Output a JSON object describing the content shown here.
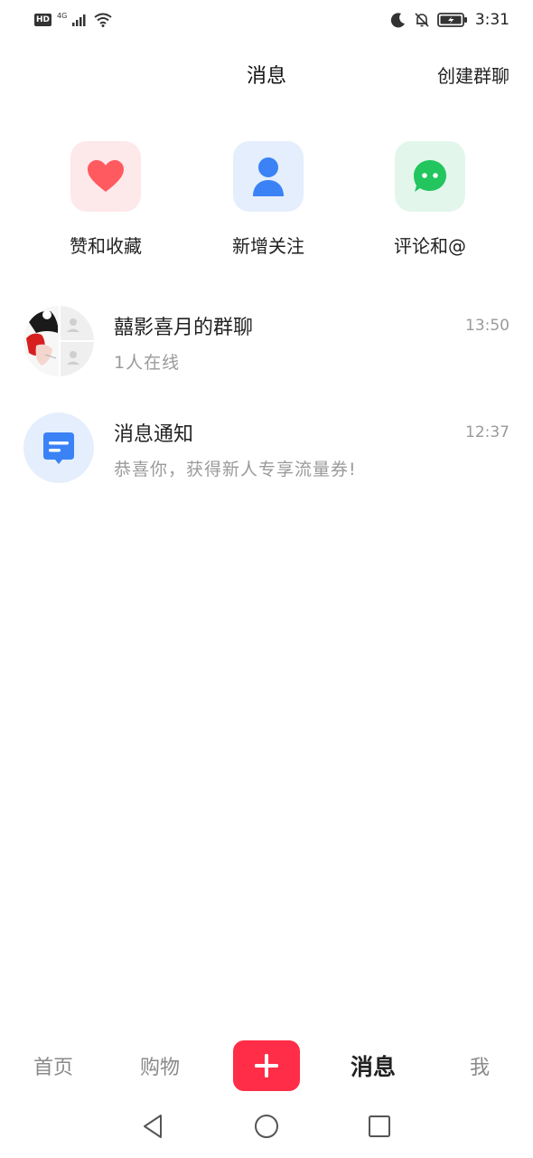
{
  "status_bar": {
    "hd_badge": "HD",
    "network": "4G",
    "time": "3:31",
    "icons": [
      "hd-badge",
      "cellular-signal-icon",
      "wifi-icon",
      "moon-icon",
      "bell-muted-icon",
      "battery-icon"
    ]
  },
  "header": {
    "title": "消息",
    "create_group": "创建群聊"
  },
  "quick_actions": [
    {
      "label": "赞和收藏",
      "icon": "heart-icon",
      "color": "#ff5a5f"
    },
    {
      "label": "新增关注",
      "icon": "person-icon",
      "color": "#3b82f6"
    },
    {
      "label": "评论和@",
      "icon": "chat-bubble-icon",
      "color": "#22c55e"
    }
  ],
  "conversations": [
    {
      "title": "囍影喜月的群聊",
      "subtitle": "1人在线",
      "time": "13:50",
      "avatar": "group-avatar"
    },
    {
      "title": "消息通知",
      "subtitle": "恭喜你，获得新人专享流量券!",
      "time": "12:37",
      "avatar": "notification-icon"
    }
  ],
  "bottom_nav": {
    "items": [
      "首页",
      "购物",
      "消息",
      "我"
    ],
    "active": "消息",
    "add_color": "#ff2d47"
  },
  "system_nav": [
    "back-icon",
    "home-icon",
    "recents-icon"
  ]
}
